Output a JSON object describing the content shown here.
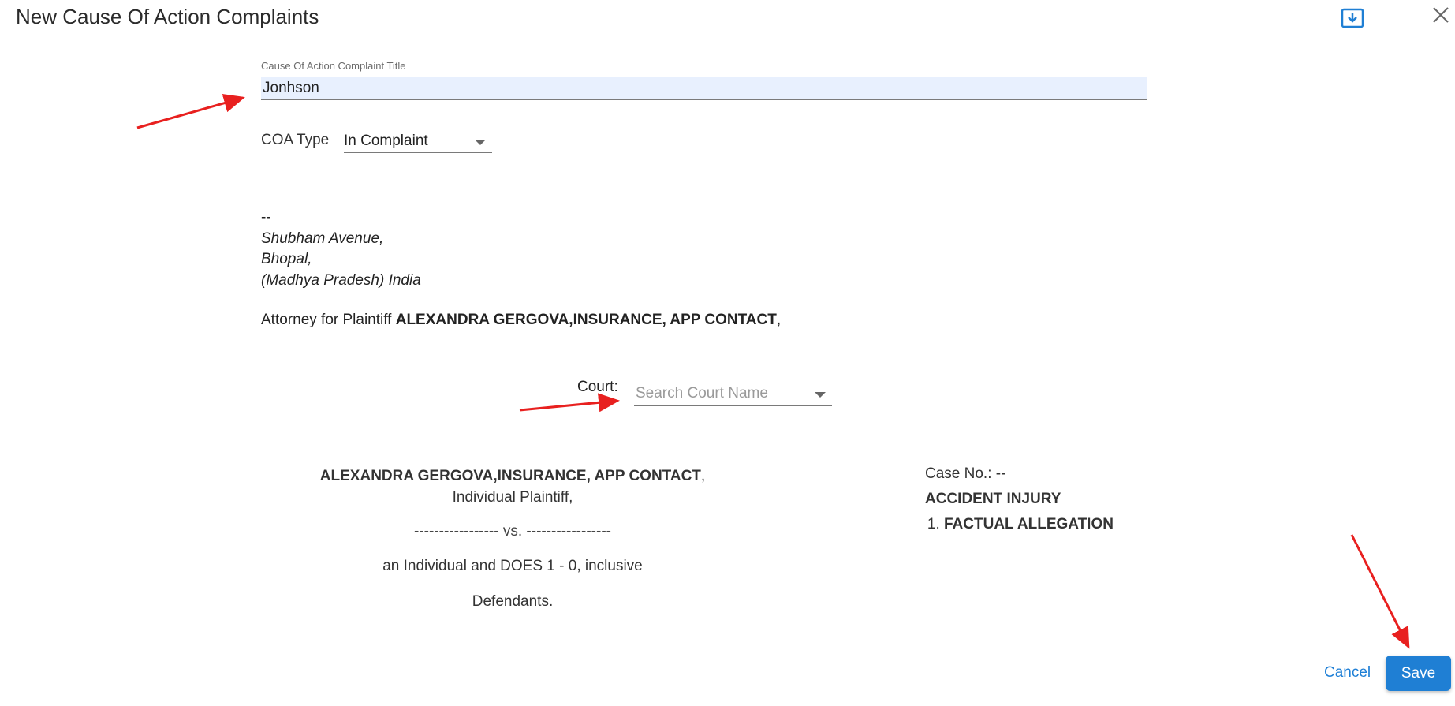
{
  "dialog": {
    "title": "New Cause Of Action Complaints",
    "download_icon": "download-icon",
    "close_icon": "close-icon"
  },
  "title_field": {
    "label": "Cause Of Action Complaint Title",
    "value": "Jonhson"
  },
  "coa_type": {
    "label": "COA Type",
    "selected": "In Complaint"
  },
  "address": {
    "dashes": "--",
    "line1": "Shubham Avenue,",
    "line2": "Bhopal,",
    "line3": "(Madhya Pradesh) India"
  },
  "attorney": {
    "prefix": "Attorney for Plaintiff",
    "names": "ALEXANDRA GERGOVA,INSURANCE, APP CONTACT",
    "suffix": ","
  },
  "court": {
    "label": "Court:",
    "placeholder": "Search Court Name"
  },
  "caption": {
    "plaintiff_names": "ALEXANDRA GERGOVA,INSURANCE, APP CONTACT",
    "plaintiff_suffix": ", Individual Plaintiff,",
    "vs_line": "----------------- vs. -----------------",
    "defendants_line": "an Individual and DOES 1 - 0, inclusive",
    "defendants_label": "Defendants."
  },
  "case": {
    "case_no": "Case No.: --",
    "heading": "ACCIDENT INJURY",
    "items": [
      "FACTUAL ALLEGATION"
    ]
  },
  "footer": {
    "cancel_label": "Cancel",
    "save_label": "Save"
  },
  "colors": {
    "accent": "#1f7fd4",
    "annotation_arrow": "#e8201f",
    "input_fill": "#e8f0fe"
  }
}
